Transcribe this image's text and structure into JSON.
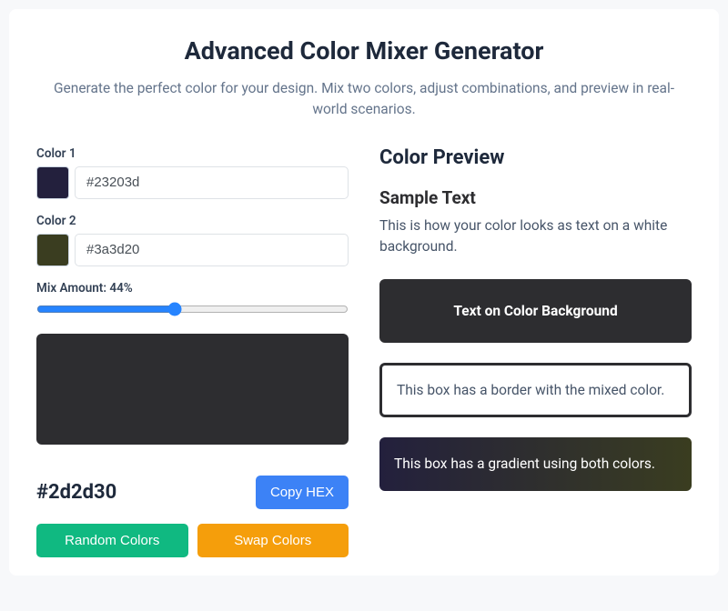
{
  "title": "Advanced Color Mixer Generator",
  "subtitle": "Generate the perfect color for your design. Mix two colors, adjust combinations, and preview in real-world scenarios.",
  "color1": {
    "label": "Color 1",
    "hex": "#23203d"
  },
  "color2": {
    "label": "Color 2",
    "hex": "#3a3d20"
  },
  "mix": {
    "percent": 44,
    "label": "Mix Amount: 44%"
  },
  "result_hex": "#2d2d30",
  "buttons": {
    "copy": "Copy HEX",
    "random": "Random Colors",
    "swap": "Swap Colors"
  },
  "preview": {
    "heading": "Color Preview",
    "sample_title": "Sample Text",
    "sample_para": "This is how your color looks as text on a white background.",
    "text_on_bg": "Text on Color Background",
    "border_text": "This box has a border with the mixed color.",
    "gradient_text": "This box has a gradient using both colors."
  }
}
